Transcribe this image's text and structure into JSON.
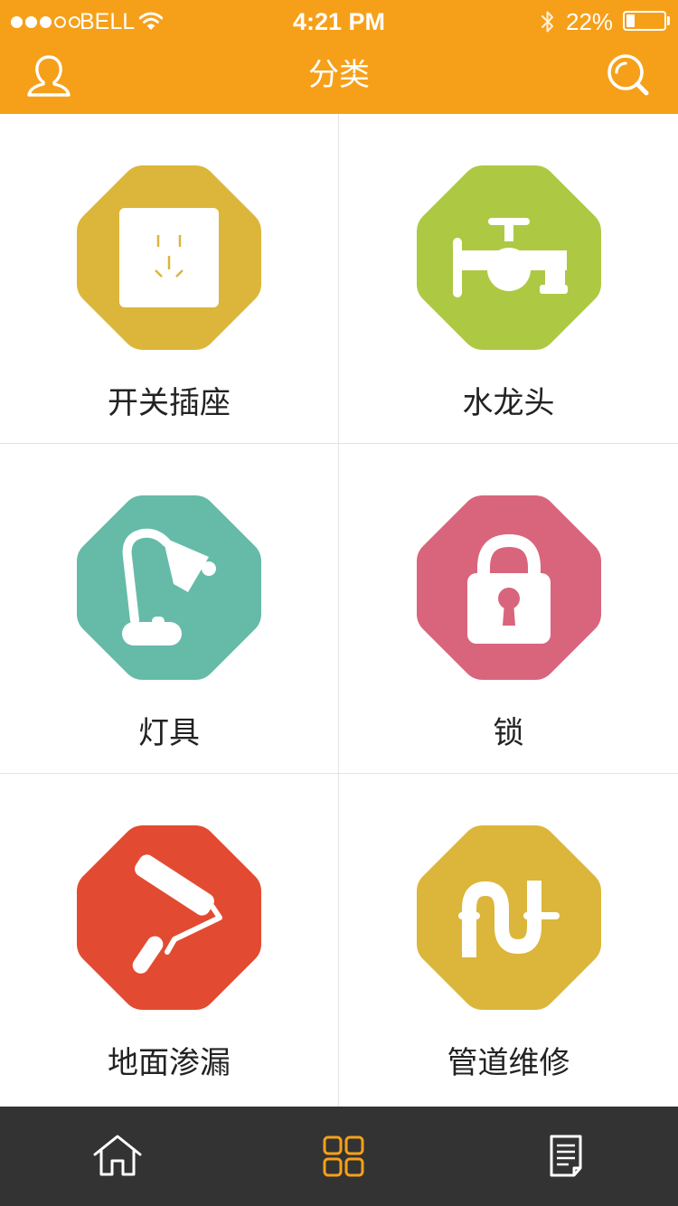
{
  "status_bar": {
    "carrier": "BELL",
    "time": "4:21 PM",
    "battery_percent_text": "22%",
    "battery_level": 0.22,
    "signal_bars_filled": 3,
    "signal_bars_total": 5
  },
  "nav": {
    "title": "分类",
    "left_icon": "user-icon",
    "right_icon": "search-icon"
  },
  "colors": {
    "header_bg": "#f6a01a",
    "tabbar_bg": "#333333",
    "tab_active": "#f6a01a",
    "tab_inactive": "#ffffff",
    "divider": "#e3e3e3"
  },
  "categories": [
    {
      "label": "开关插座",
      "icon": "power-socket-icon",
      "color": "#dbb63a"
    },
    {
      "label": "水龙头",
      "icon": "faucet-icon",
      "color": "#adc943"
    },
    {
      "label": "灯具",
      "icon": "desk-lamp-icon",
      "color": "#65bba8"
    },
    {
      "label": "锁",
      "icon": "padlock-icon",
      "color": "#d9657d"
    },
    {
      "label": "地面渗漏",
      "icon": "paint-roller-icon",
      "color": "#e24b31"
    },
    {
      "label": "管道维修",
      "icon": "pipe-icon",
      "color": "#dbb63a"
    }
  ],
  "tabbar": {
    "active_index": 1,
    "tabs": [
      {
        "icon": "home-icon"
      },
      {
        "icon": "grid-icon"
      },
      {
        "icon": "document-icon"
      }
    ]
  }
}
